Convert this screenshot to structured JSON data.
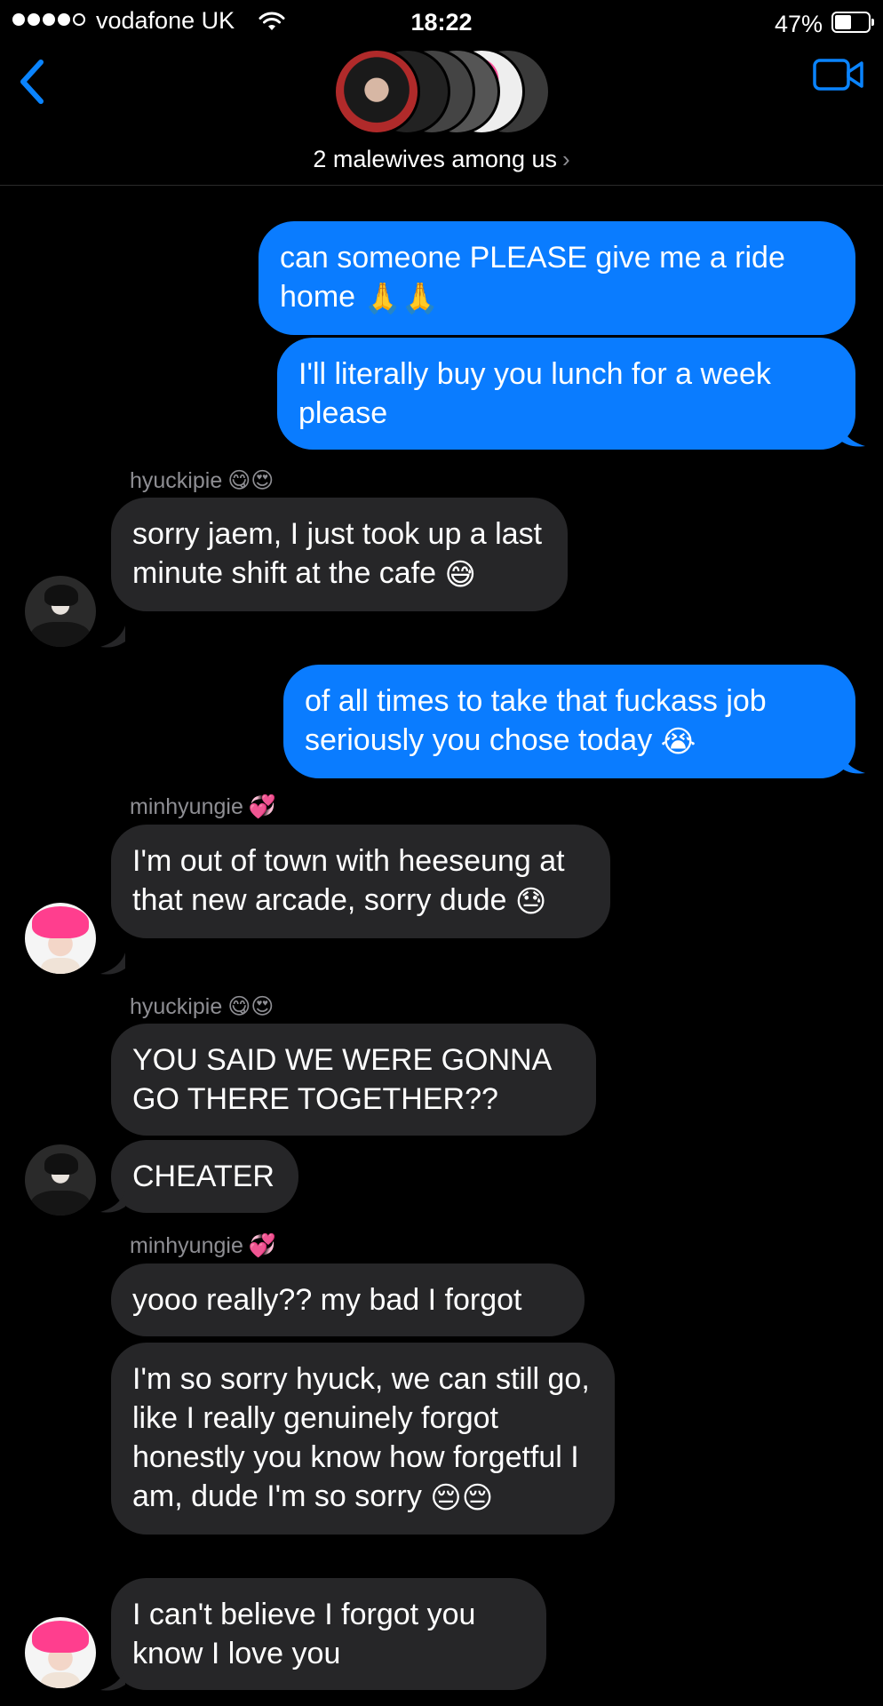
{
  "status_bar": {
    "carrier": "vodafone UK",
    "time": "18:22",
    "battery": "47%",
    "battery_level": 0.47,
    "signal_bars": 4
  },
  "header": {
    "group_name": "2 malewives among us",
    "icons": [
      "chevron-left-icon",
      "video-camera-icon",
      "chevron-right-icon"
    ]
  },
  "messages": [
    {
      "direction": "out",
      "text": "can someone PLEASE give me a ride home",
      "emoji": "🙏🙏"
    },
    {
      "direction": "out",
      "text": "I'll literally buy you lunch for a week please",
      "emoji": ""
    },
    {
      "direction": "in",
      "sender": "hyuckipie",
      "sender_emoji": "😋😍",
      "text": "sorry jaem, I just took up a last minute shift at the cafe",
      "emoji": "😅"
    },
    {
      "direction": "out",
      "text": "of all times to take that fuckass job seriously you chose today",
      "emoji": "😭"
    },
    {
      "direction": "in",
      "sender": "minhyungie",
      "sender_emoji": "💞",
      "text": "I'm out of town with heeseung at that new arcade, sorry dude",
      "emoji": "😓"
    },
    {
      "direction": "in",
      "sender": "hyuckipie",
      "sender_emoji": "😋😍",
      "text": "YOU SAID WE WERE GONNA GO THERE TOGETHER??",
      "emoji": ""
    },
    {
      "direction": "in",
      "text": "CHEATER",
      "emoji": ""
    },
    {
      "direction": "in",
      "sender": "minhyungie",
      "sender_emoji": "💞",
      "text": "yooo really?? my bad I forgot",
      "emoji": ""
    },
    {
      "direction": "in",
      "text": "I'm so sorry hyuck, we can still go, like I really genuinely forgot honestly you know how forgetful I am, dude I'm so sorry",
      "emoji": "😔😔"
    },
    {
      "direction": "in",
      "text": "I can't believe I forgot you know I love you",
      "emoji": ""
    }
  ],
  "colors": {
    "background": "#000000",
    "outgoing_bubble": "#0a7cff",
    "incoming_bubble": "#262628",
    "accent": "#0a84ff",
    "sender_label": "#8e8e93"
  }
}
